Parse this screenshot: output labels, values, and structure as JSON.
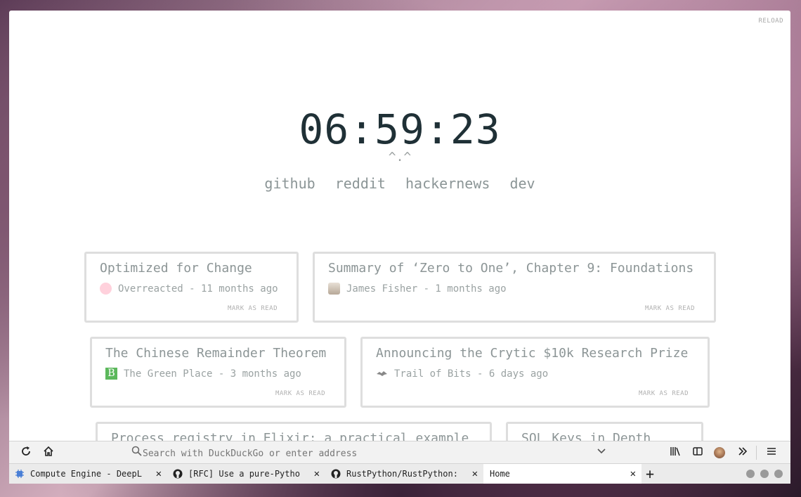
{
  "page": {
    "reload_label": "RELOAD",
    "clock": "06:59:23",
    "face": "^.^",
    "links": [
      "github",
      "reddit",
      "hackernews",
      "dev"
    ]
  },
  "cards": [
    {
      "title": "Optimized for Change",
      "meta": "Overreacted - 11 months ago",
      "fav_color": "#ffd1dc",
      "mark": "MARK AS READ"
    },
    {
      "title": "Summary of ‘Zero to One’, Chapter 9: Foundations",
      "meta": "James Fisher - 1 months ago",
      "fav_color": "#d9d2c8",
      "mark": "MARK AS READ"
    },
    {
      "title": "The Chinese Remainder Theorem",
      "meta": "The Green Place - 3 months ago",
      "fav_color": "#5cb85c",
      "fav_letter": "B",
      "mark": "MARK AS READ"
    },
    {
      "title": "Announcing the Crytic $10k Research Prize",
      "meta": "Trail of Bits - 6 days ago",
      "fav_color": "#ffffff",
      "mark": "MARK AS READ"
    },
    {
      "title": "Process registry in Elixir: a practical example",
      "meta": "",
      "mark": ""
    },
    {
      "title": "SQL Keys in Depth",
      "meta": "",
      "mark": ""
    }
  ],
  "toolbar": {
    "search_placeholder": "Search with DuckDuckGo or enter address"
  },
  "tabs": [
    {
      "label": "Compute Engine - DeepL",
      "icon": "chip-icon"
    },
    {
      "label": "[RFC] Use a pure-Pytho",
      "icon": "github-icon"
    },
    {
      "label": "RustPython/RustPython:",
      "icon": "github-icon"
    },
    {
      "label": "Home",
      "icon": ""
    }
  ]
}
